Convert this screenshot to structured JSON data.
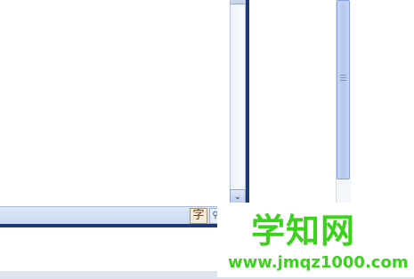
{
  "left_window": {
    "scroll_down_glyph": "⌄",
    "ime_char": "字",
    "search_glyph": "⚲"
  },
  "watermark": {
    "title": "学知网",
    "url": "www.jmqz1000.com"
  },
  "colors": {
    "window_border": "#1c3a78",
    "scroll_thumb": "#b5c8ee",
    "watermark_green": "#3ad21a"
  }
}
